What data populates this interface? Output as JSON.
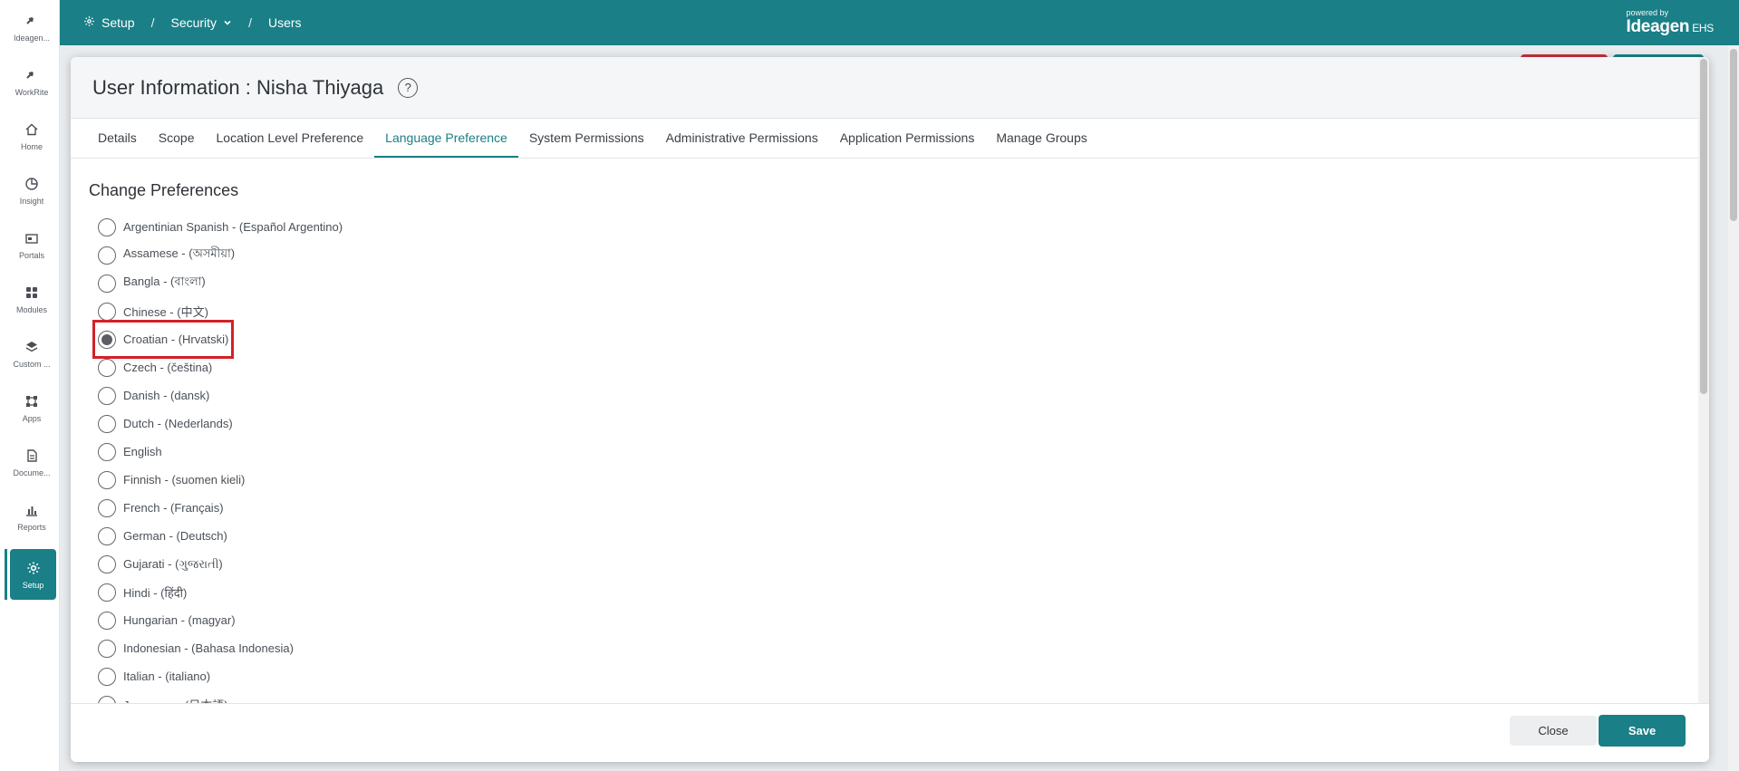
{
  "rail": {
    "items": [
      {
        "label": "Ideagen...",
        "icon": "ideagen-logo-icon"
      },
      {
        "label": "WorkRite",
        "icon": "workrite-logo-icon"
      },
      {
        "label": "Home",
        "icon": "home-icon"
      },
      {
        "label": "Insight",
        "icon": "pie-chart-icon"
      },
      {
        "label": "Portals",
        "icon": "portal-icon"
      },
      {
        "label": "Modules",
        "icon": "grid-icon"
      },
      {
        "label": "Custom ...",
        "icon": "layers-icon"
      },
      {
        "label": "Apps",
        "icon": "apps-icon"
      },
      {
        "label": "Docume...",
        "icon": "document-icon"
      },
      {
        "label": "Reports",
        "icon": "bar-chart-icon"
      },
      {
        "label": "Setup",
        "icon": "gear-icon"
      }
    ],
    "active": "Setup"
  },
  "topbar": {
    "crumbs": {
      "setup": "Setup",
      "security": "Security",
      "users": "Users"
    },
    "sep": "/",
    "brand": {
      "powered": "powered by",
      "name": "Ideagen",
      "suffix": "EHS"
    },
    "color": "#1a7f86"
  },
  "modal": {
    "title": "User Information : Nisha Thiyaga",
    "help": "?",
    "tabs": [
      {
        "label": "Details"
      },
      {
        "label": "Scope"
      },
      {
        "label": "Location Level Preference"
      },
      {
        "label": "Language Preference"
      },
      {
        "label": "System Permissions"
      },
      {
        "label": "Administrative Permissions"
      },
      {
        "label": "Application Permissions"
      },
      {
        "label": "Manage Groups"
      }
    ],
    "active_tab": "Language Preference",
    "section_title": "Change Preferences",
    "languages": [
      "Argentinian Spanish - (Español Argentino)",
      "Assamese - (অসমীয়া)",
      "Bangla - (বাংলা)",
      "Chinese - (中文)",
      "Croatian - (Hrvatski)",
      "Czech - (čeština)",
      "Danish - (dansk)",
      "Dutch - (Nederlands)",
      "English",
      "Finnish - (suomen kieli)",
      "French - (Français)",
      "German - (Deutsch)",
      "Gujarati - (ગુજરાતી)",
      "Hindi - (हिंदी)",
      "Hungarian - (magyar)",
      "Indonesian - (Bahasa Indonesia)",
      "Italian - (italiano)",
      "Japanese - (日本語)"
    ],
    "selected_language": "Croatian - (Hrvatski)",
    "buttons": {
      "close": "Close",
      "save": "Save"
    }
  }
}
